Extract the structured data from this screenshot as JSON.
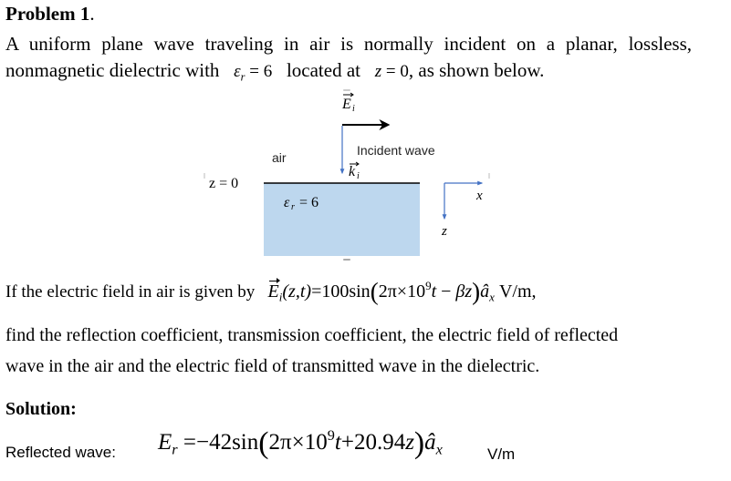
{
  "problem": {
    "title": "Problem 1",
    "title_punct": ".",
    "intro_line1": "A uniform plane wave traveling in air is normally incident on a planar, lossless,",
    "intro_line2_a": "nonmagnetic dielectric with",
    "intro_line2_eps_symbol": "ε",
    "intro_line2_eps_sub": "r",
    "intro_line2_eps_value": "= 6",
    "intro_line2_b": "located at",
    "intro_line2_z": "z",
    "intro_line2_z_value": "= 0",
    "intro_line2_c": ", as shown below."
  },
  "diagram": {
    "e_field_label": "E",
    "e_field_sub": "i",
    "k_label": "k",
    "k_sub": "i",
    "incident_label": "Incident wave",
    "air_label": "air",
    "interface_label": "z = 0",
    "dielectric_label_symbol": "ε",
    "dielectric_label_sub": "r",
    "dielectric_label_value": " = 6",
    "axis_x_label": "x",
    "axis_z_label": "z",
    "colors": {
      "dielectric_fill": "#BDD7EE",
      "axis_arrow": "#4472C4",
      "e_arrow": "#000000",
      "interface_line": "#000000"
    }
  },
  "given": {
    "lead_text": "If the electric field in air is given by",
    "field_symbol": "E",
    "field_sub": "i",
    "args": "(z,t)",
    "equals": "=",
    "amplitude": "100",
    "func": "sin",
    "omega_coeff": "2π",
    "times": "×",
    "ten": "10",
    "exp": "9",
    "t": "t",
    "minus": " − ",
    "beta_z": "βz",
    "unit_vec": "â",
    "unit_vec_sub": "x",
    "units": "V/m",
    "trailing": ","
  },
  "task": {
    "line1": "find the reflection coefficient, transmission coefficient, the electric field of reflected",
    "line2": "wave in the air and the electric field of transmitted wave in the dielectric."
  },
  "solution": {
    "heading": "Solution:",
    "reflected_label": "Reflected wave:",
    "reflected_symbol": "E",
    "reflected_sub": "r",
    "reflected_equals": "=",
    "reflected_amplitude": "−42",
    "reflected_func": "sin",
    "reflected_omega": "2π",
    "reflected_times": "×",
    "reflected_ten": "10",
    "reflected_exp": "9",
    "reflected_t": "t",
    "reflected_plus": "+",
    "reflected_beta": "20.94",
    "reflected_z": "z",
    "reflected_unit_vec": "â",
    "reflected_unit_sub": "x",
    "reflected_units": "V/m"
  }
}
